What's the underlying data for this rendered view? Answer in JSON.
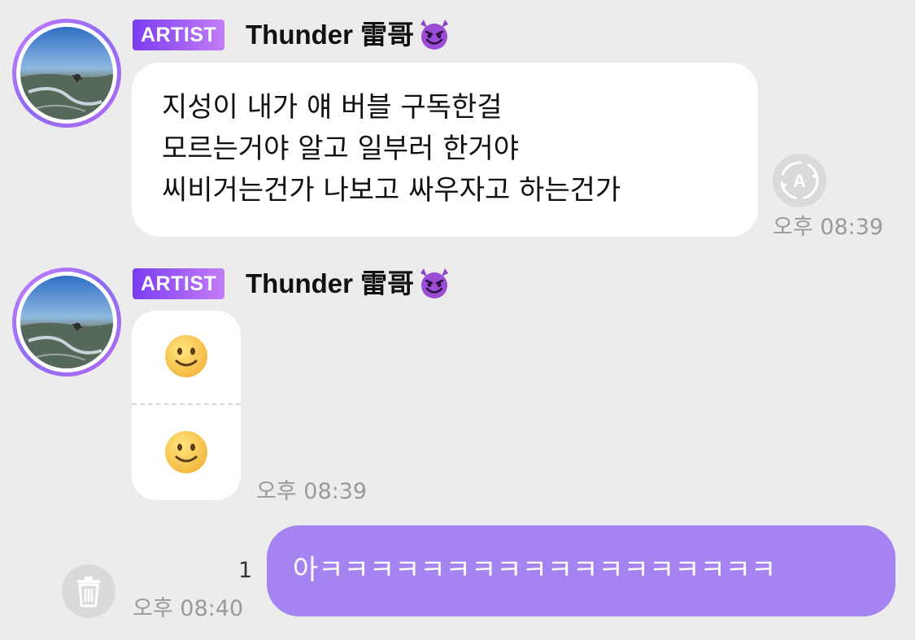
{
  "sender": {
    "badge": "ARTIST",
    "name": "Thunder 雷哥",
    "emoji_icon": "smiling-devil-icon"
  },
  "messages": [
    {
      "lines": [
        "지성이 내가 얘 버블 구독한걸",
        "모르는거야 알고 일부러 한거야",
        "씨비거는건가 나보고 싸우자고 하는건가"
      ],
      "time": "오후 08:39"
    },
    {
      "emojis": [
        "🙂",
        "🙂"
      ],
      "time": "오후 08:39"
    }
  ],
  "outgoing": {
    "text": "아ㅋㅋㅋㅋㅋㅋㅋㅋㅋㅋㅋㅋㅋㅋㅋㅋㅋㅋ",
    "read_count": "1",
    "time": "오후 08:40"
  },
  "colors": {
    "background": "#ececec",
    "outgoing_bubble": "#a583f0",
    "badge_start": "#7b3cf0",
    "badge_end": "#c27ef5"
  }
}
